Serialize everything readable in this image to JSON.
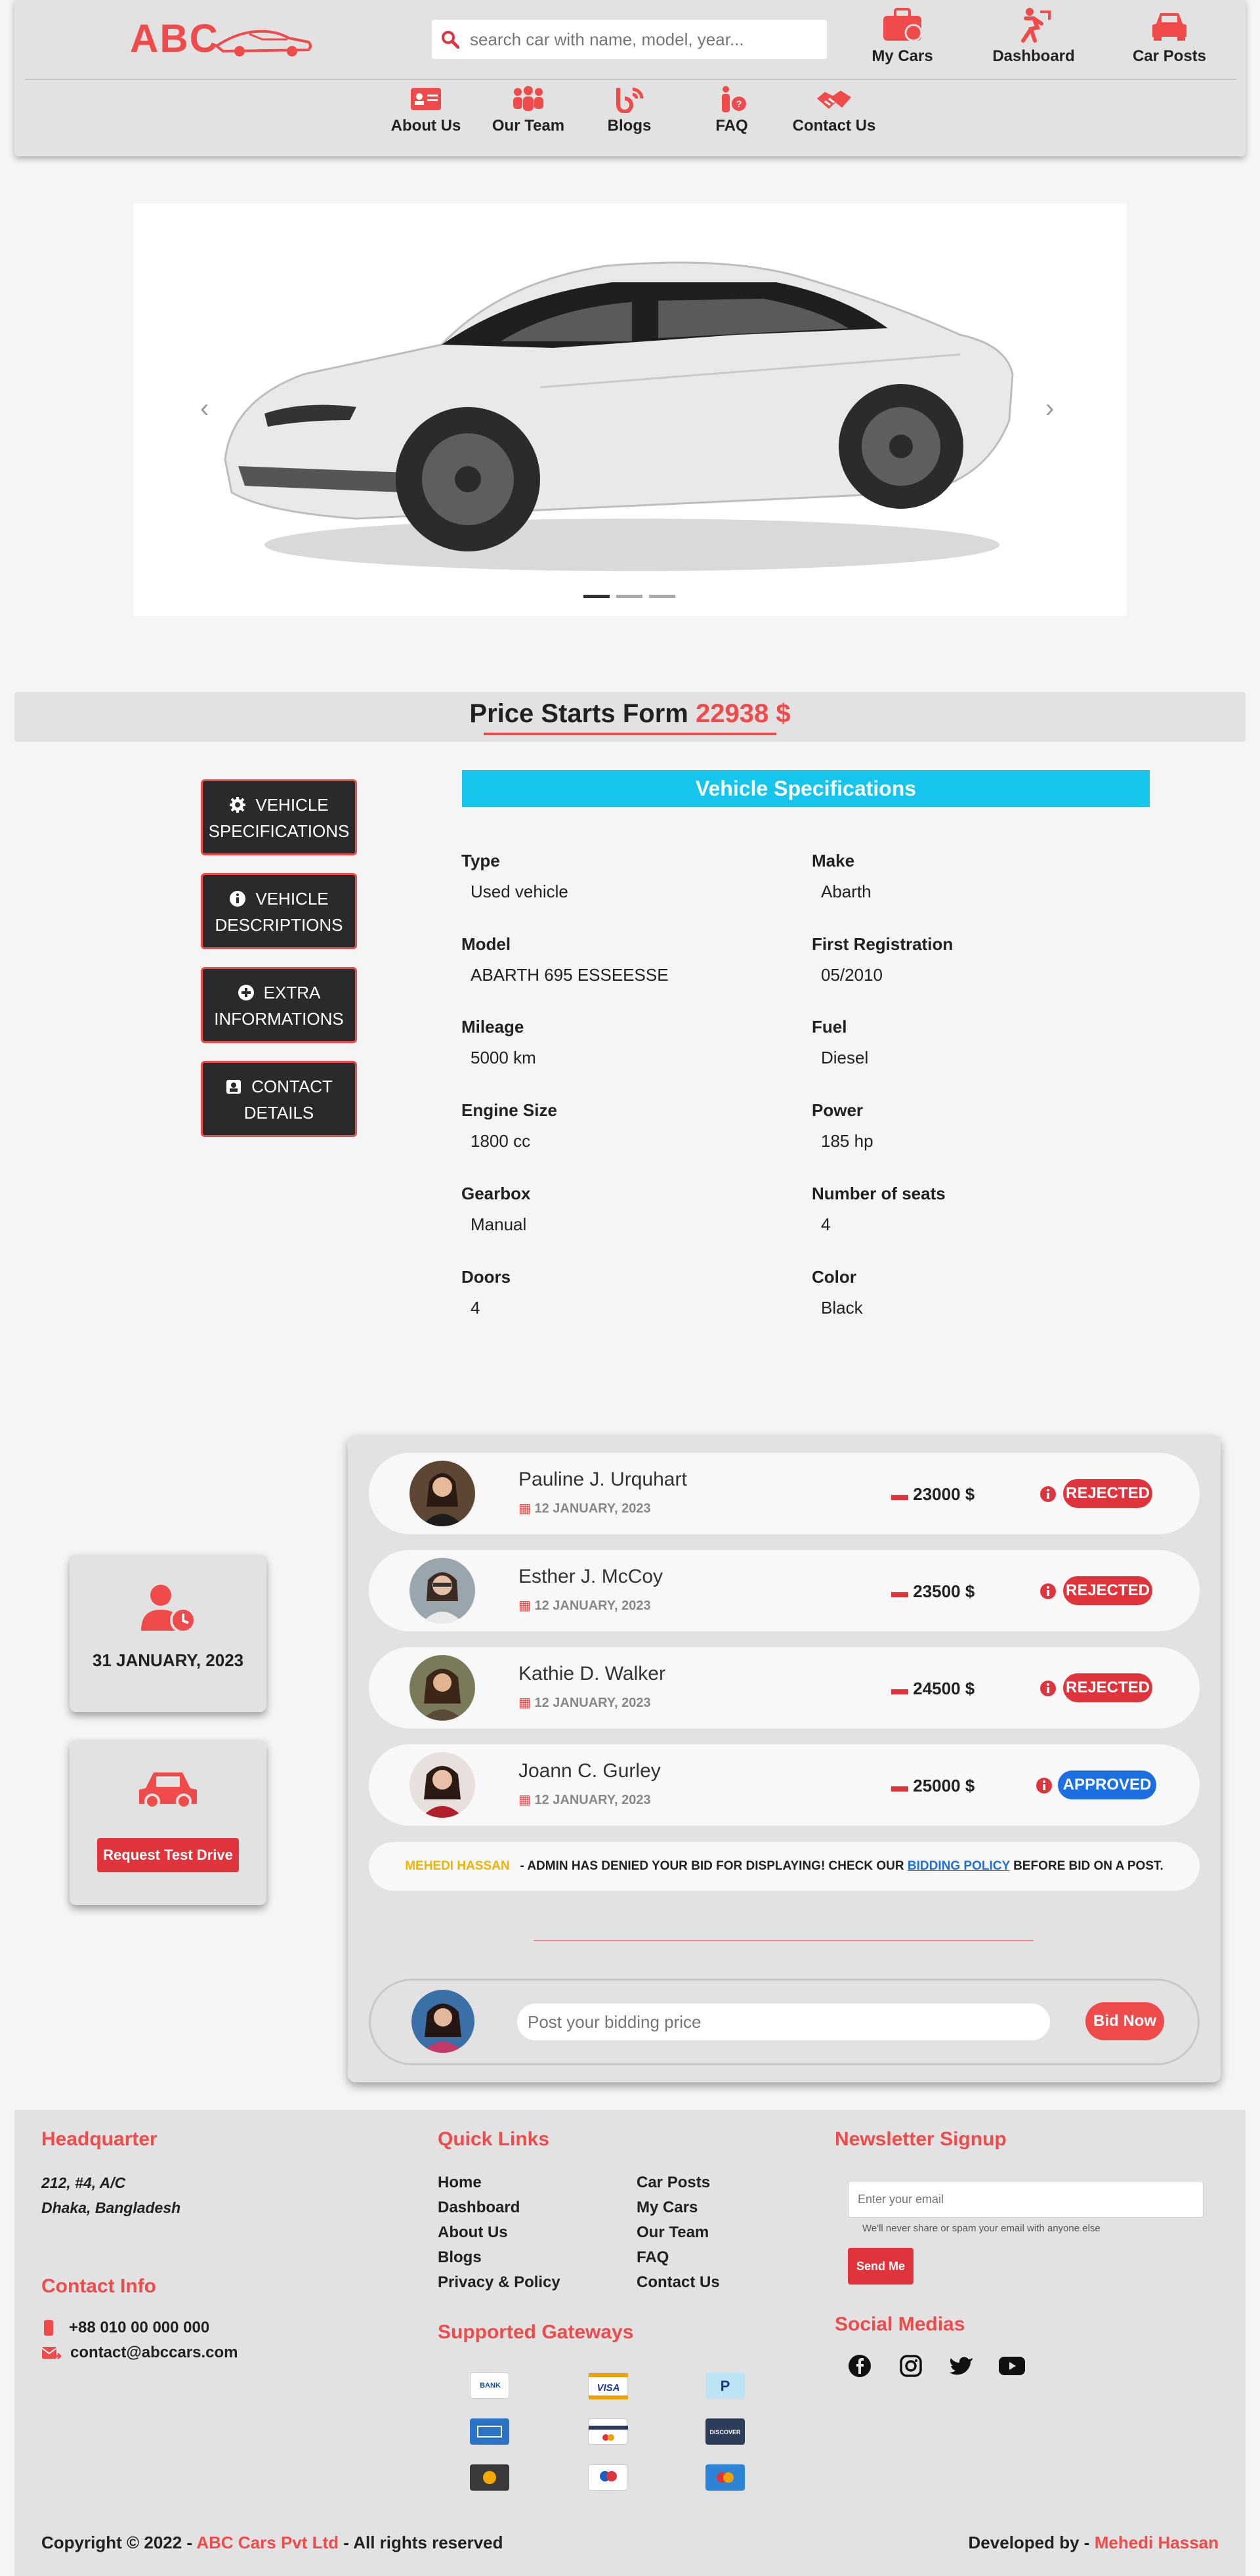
{
  "header": {
    "logo_text": "ABC",
    "search_placeholder": "search car with name, model, year...",
    "top_nav": [
      {
        "label": "My Cars",
        "icon": "briefcase-car-icon"
      },
      {
        "label": "Dashboard",
        "icon": "person-running-icon"
      },
      {
        "label": "Car Posts",
        "icon": "car-icon"
      }
    ],
    "sub_nav": [
      {
        "label": "About Us",
        "icon": "id-card-icon"
      },
      {
        "label": "Our Team",
        "icon": "team-icon"
      },
      {
        "label": "Blogs",
        "icon": "blog-icon"
      },
      {
        "label": "FAQ",
        "icon": "faq-person-icon"
      },
      {
        "label": "Contact Us",
        "icon": "handshake-icon"
      }
    ]
  },
  "carousel": {
    "slide_count": 3,
    "active_slide": 1
  },
  "price": {
    "label": "Price Starts Form",
    "value": "22938 $"
  },
  "side_tabs": [
    {
      "line1": "VEHICLE",
      "line2": "SPECIFICATIONS",
      "icon": "gear-icon"
    },
    {
      "line1": "VEHICLE",
      "line2": "DESCRIPTIONS",
      "icon": "info-icon"
    },
    {
      "line1": "EXTRA",
      "line2": "INFORMATIONS",
      "icon": "plus-circle-icon"
    },
    {
      "line1": "CONTACT",
      "line2": "DETAILS",
      "icon": "contact-card-icon"
    }
  ],
  "specs": {
    "title": "Vehicle Specifications",
    "items": [
      {
        "label": "Type",
        "value": "Used vehicle"
      },
      {
        "label": "Make",
        "value": "Abarth"
      },
      {
        "label": "Model",
        "value": "ABARTH 695 ESSEESSE"
      },
      {
        "label": "First Registration",
        "value": "05/2010"
      },
      {
        "label": "Mileage",
        "value": "5000 km"
      },
      {
        "label": "Fuel",
        "value": "Diesel"
      },
      {
        "label": "Engine Size",
        "value": "1800 cc"
      },
      {
        "label": "Power",
        "value": "185 hp"
      },
      {
        "label": "Gearbox",
        "value": "Manual"
      },
      {
        "label": "Number of seats",
        "value": "4"
      },
      {
        "label": "Doors",
        "value": "4"
      },
      {
        "label": "Color",
        "value": "Black"
      }
    ]
  },
  "date_card": {
    "date": "31 JANUARY, 2023",
    "icon": "user-clock-icon"
  },
  "test_drive": {
    "button": "Request Test Drive",
    "icon": "car-icon"
  },
  "bids": [
    {
      "name": "Pauline J. Urquhart",
      "date": "12 JANUARY, 2023",
      "amount": "23000 $",
      "status": "REJECTED",
      "status_color": "#e0343d"
    },
    {
      "name": "Esther J. McCoy",
      "date": "12 JANUARY, 2023",
      "amount": "23500 $",
      "status": "REJECTED",
      "status_color": "#e0343d"
    },
    {
      "name": "Kathie D. Walker",
      "date": "12 JANUARY, 2023",
      "amount": "24500 $",
      "status": "REJECTED",
      "status_color": "#e0343d"
    },
    {
      "name": "Joann C. Gurley",
      "date": "12 JANUARY, 2023",
      "amount": "25000 $",
      "status": "APPROVED",
      "status_color": "#1c6fe0"
    }
  ],
  "notice": {
    "user": "MEHEDI HASSAN",
    "message": "- ADMIN HAS DENIED YOUR BID FOR DISPLAYING! CHECK OUR",
    "link": "BIDDING POLICY",
    "tail": "BEFORE BID ON A POST."
  },
  "bid_form": {
    "placeholder": "Post your bidding price",
    "button": "Bid Now"
  },
  "footer": {
    "hq_title": "Headquarter",
    "hq_line1": "212, #4, A/C",
    "hq_line2": "Dhaka, Bangladesh",
    "contact_title": "Contact Info",
    "phone": "+88 010 00 000 000",
    "email": "contact@abccars.com",
    "links_title": "Quick Links",
    "links_col1": [
      "Home",
      "Dashboard",
      "About Us",
      "Blogs",
      "Privacy & Policy"
    ],
    "links_col2": [
      "Car Posts",
      "My Cars",
      "Our Team",
      "FAQ",
      "Contact Us"
    ],
    "gateways_title": "Supported Gateways",
    "gateways": [
      "bank",
      "visa",
      "paypal",
      "american-express",
      "credit-card",
      "discover",
      "bitcoin",
      "maestro",
      "mastercard"
    ],
    "newsletter_title": "Newsletter Signup",
    "newsletter_placeholder": "Enter your email",
    "newsletter_note": "We'll never share or spam your email with anyone else",
    "newsletter_button": "Send Me",
    "social_title": "Social Medias",
    "social": [
      "facebook-icon",
      "instagram-icon",
      "twitter-icon",
      "youtube-icon"
    ],
    "copyright_prefix": "Copyright © 2022 -",
    "company": "ABC Cars Pvt Ltd",
    "copyright_suffix": "- All rights reserved",
    "dev_prefix": "Developed by -",
    "developer": "Mehedi Hassan"
  },
  "colors": {
    "accent": "#ef4b4b",
    "spec_header": "#16c5ec",
    "notice_user": "#f0b400",
    "link": "#1c6fe0"
  }
}
